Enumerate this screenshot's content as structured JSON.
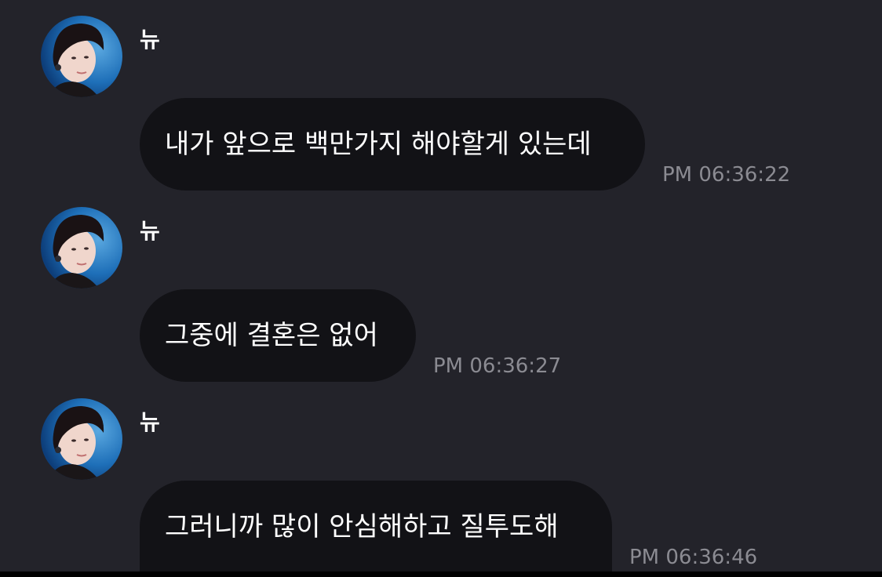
{
  "messages": [
    {
      "sender": "뉴",
      "text": "내가 앞으로 백만가지 해야할게 있는데",
      "time": "PM 06:36:22"
    },
    {
      "sender": "뉴",
      "text": "그중에 결혼은 없어",
      "time": "PM 06:36:27"
    },
    {
      "sender": "뉴",
      "text": "그러니까 많이 안심해하고 질투도해",
      "time": "PM 06:36:46"
    }
  ],
  "colors": {
    "background": "#23232a",
    "bubble": "#121216",
    "message_text": "#ffffff",
    "timestamp": "#8b8b92",
    "avatar_ring": "#1e6fb8"
  },
  "icons": {
    "avatar": "profile-photo"
  }
}
